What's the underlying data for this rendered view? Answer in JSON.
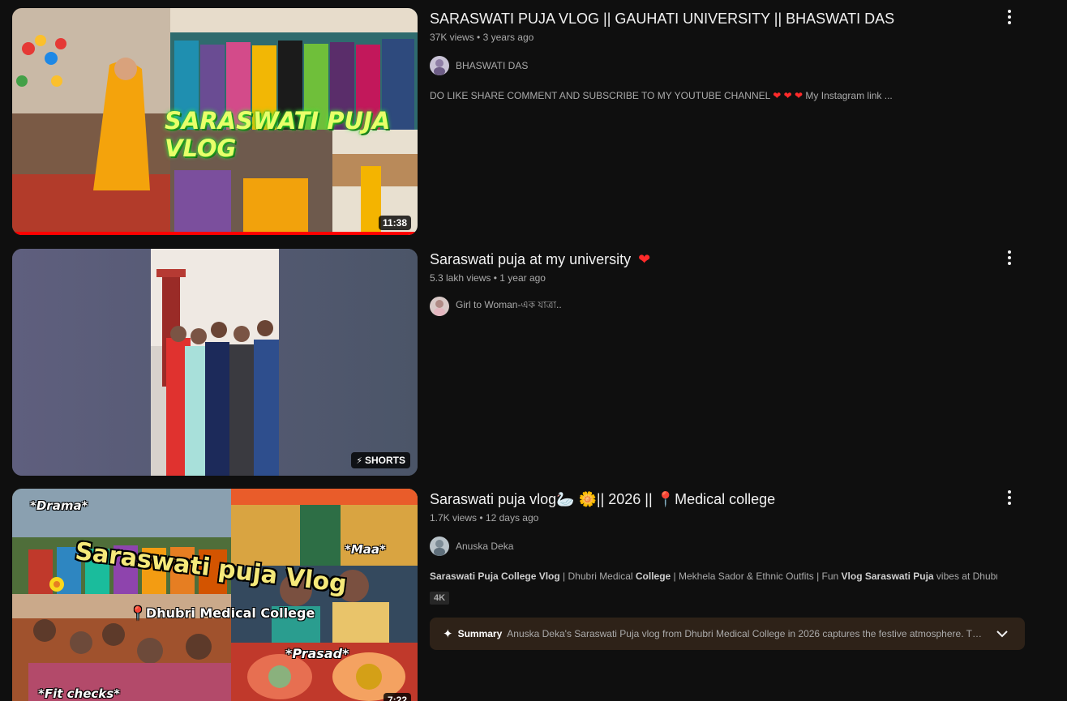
{
  "videos": [
    {
      "title": "SARASWATI PUJA VLOG || GAUHATI UNIVERSITY || BHASWATI DAS",
      "views": "37K views",
      "age": "3 years ago",
      "channel": "BHASWATI DAS",
      "description": "DO LIKE SHARE COMMENT AND SUBSCRIBE TO MY YOUTUBE CHANNEL",
      "description_hearts": "❤ ❤ ❤",
      "description_tail": "My Instagram link  ...",
      "duration": "11:38",
      "thumb_text": "SARASWATI PUJA VLOG",
      "watched_fraction": 1.0
    },
    {
      "title": "Saraswati puja at my university",
      "title_emoji": "❤",
      "views": "5.3 lakh views",
      "age": "1 year ago",
      "channel": "Girl to Woman-এক যাত্রা..",
      "badge": "SHORTS"
    },
    {
      "title": "Saraswati puja vlog🦢 🌼|| 2026 || 📍Medical college",
      "views": "1.7K views",
      "age": "12 days ago",
      "channel": "Anuska Deka",
      "desc_parts": [
        {
          "b": "Saraswati Puja College Vlog"
        },
        {
          "t": " | Dhubri Medical "
        },
        {
          "b": "College"
        },
        {
          "t": " | Mekhela Sador & Ethnic Outfits | Fun "
        },
        {
          "b": "Vlog Saraswati Puja"
        },
        {
          "t": " vibes at Dhubri ..."
        }
      ],
      "quality": "4K",
      "summary_label": "Summary",
      "summary_text": "Anuska Deka's Saraswati Puja vlog from Dhubri Medical College in 2026 captures the festive atmosphere. The...",
      "duration": "7:22",
      "thumb_labels": {
        "drama": "*Drama*",
        "maa": "*Maa*",
        "main": "Saraswati puja Vlog",
        "college": "📍Dhubri Medical College",
        "prasad": "*Prasad*",
        "fit": "*Fit checks*"
      }
    }
  ],
  "colors": {
    "background": "#0f0f0f",
    "progress": "#ff0000",
    "summary_bg": "#2e2218"
  }
}
